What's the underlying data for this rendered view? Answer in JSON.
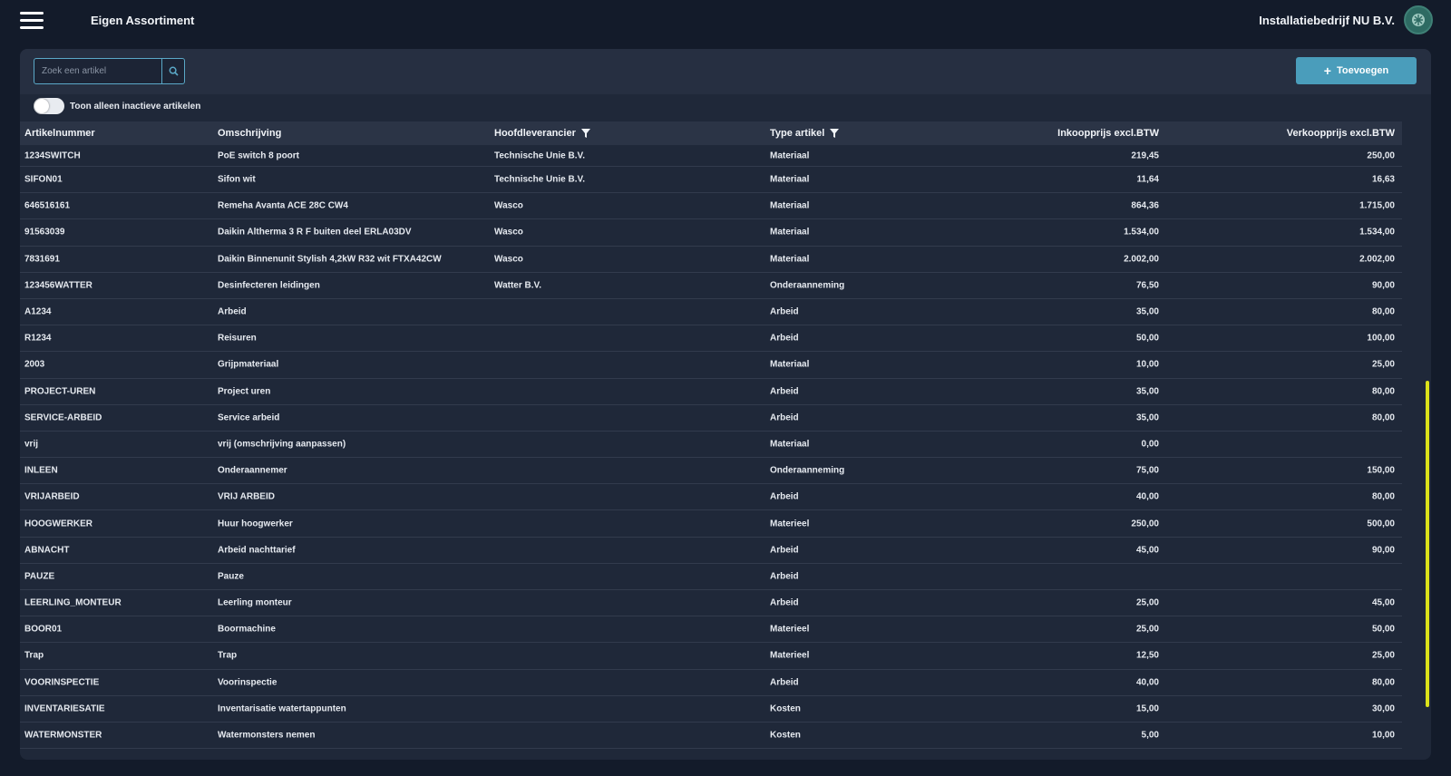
{
  "header": {
    "menu_icon": "hamburger-icon",
    "title": "Eigen Assortiment",
    "company": "Installatiebedrijf NU B.V.",
    "avatar_icon": "avatar-icon"
  },
  "toolbar": {
    "search_placeholder": "Zoek een artikel",
    "search_icon": "search-icon",
    "add_label": "Toevoegen",
    "add_icon": "plus-icon",
    "toggle_label": "Toon alleen inactieve artikelen"
  },
  "colors": {
    "accent": "#4a9dbb",
    "background": "#131b2a",
    "panel": "#1f2839",
    "scrollbar": "#dbe21a"
  },
  "table": {
    "columns": [
      "Artikelnummer",
      "Omschrijving",
      "Hoofdleverancier",
      "Type artikel",
      "Inkoopprijs excl.BTW",
      "Verkoopprijs excl.BTW"
    ],
    "rows": [
      [
        "1234SWITCH",
        "PoE switch 8 poort",
        "Technische Unie B.V.",
        "Materiaal",
        "219,45",
        "250,00"
      ],
      [
        "SIFON01",
        "Sifon wit",
        "Technische Unie B.V.",
        "Materiaal",
        "11,64",
        "16,63"
      ],
      [
        "646516161",
        "Remeha Avanta ACE 28C CW4",
        "Wasco",
        "Materiaal",
        "864,36",
        "1.715,00"
      ],
      [
        "91563039",
        "Daikin Altherma 3 R F buiten deel ERLA03DV",
        "Wasco",
        "Materiaal",
        "1.534,00",
        "1.534,00"
      ],
      [
        "7831691",
        "Daikin Binnenunit Stylish 4,2kW R32 wit FTXA42CW",
        "Wasco",
        "Materiaal",
        "2.002,00",
        "2.002,00"
      ],
      [
        "123456WATTER",
        "Desinfecteren leidingen",
        "Watter B.V.",
        "Onderaanneming",
        "76,50",
        "90,00"
      ],
      [
        "A1234",
        "Arbeid",
        "",
        "Arbeid",
        "35,00",
        "80,00"
      ],
      [
        "R1234",
        "Reisuren",
        "",
        "Arbeid",
        "50,00",
        "100,00"
      ],
      [
        "2003",
        "Grijpmateriaal",
        "",
        "Materiaal",
        "10,00",
        "25,00"
      ],
      [
        "PROJECT-UREN",
        "Project uren",
        "",
        "Arbeid",
        "35,00",
        "80,00"
      ],
      [
        "SERVICE-ARBEID",
        "Service arbeid",
        "",
        "Arbeid",
        "35,00",
        "80,00"
      ],
      [
        "vrij",
        "vrij (omschrijving aanpassen)",
        "",
        "Materiaal",
        "0,00",
        ""
      ],
      [
        "INLEEN",
        "Onderaannemer",
        "",
        "Onderaanneming",
        "75,00",
        "150,00"
      ],
      [
        "VRIJARBEID",
        "VRIJ ARBEID",
        "",
        "Arbeid",
        "40,00",
        "80,00"
      ],
      [
        "HOOGWERKER",
        "Huur hoogwerker",
        "",
        "Materieel",
        "250,00",
        "500,00"
      ],
      [
        "ABNACHT",
        "Arbeid nachttarief",
        "",
        "Arbeid",
        "45,00",
        "90,00"
      ],
      [
        "PAUZE",
        "Pauze",
        "",
        "Arbeid",
        "",
        ""
      ],
      [
        "LEERLING_MONTEUR",
        "Leerling monteur",
        "",
        "Arbeid",
        "25,00",
        "45,00"
      ],
      [
        "BOOR01",
        "Boormachine",
        "",
        "Materieel",
        "25,00",
        "50,00"
      ],
      [
        "Trap",
        "Trap",
        "",
        "Materieel",
        "12,50",
        "25,00"
      ],
      [
        "VOORINSPECTIE",
        "Voorinspectie",
        "",
        "Arbeid",
        "40,00",
        "80,00"
      ],
      [
        "INVENTARIESATIE",
        "Inventarisatie watertappunten",
        "",
        "Kosten",
        "15,00",
        "30,00"
      ],
      [
        "WATERMONSTER",
        "Watermonsters nemen",
        "",
        "Kosten",
        "5,00",
        "10,00"
      ]
    ]
  }
}
